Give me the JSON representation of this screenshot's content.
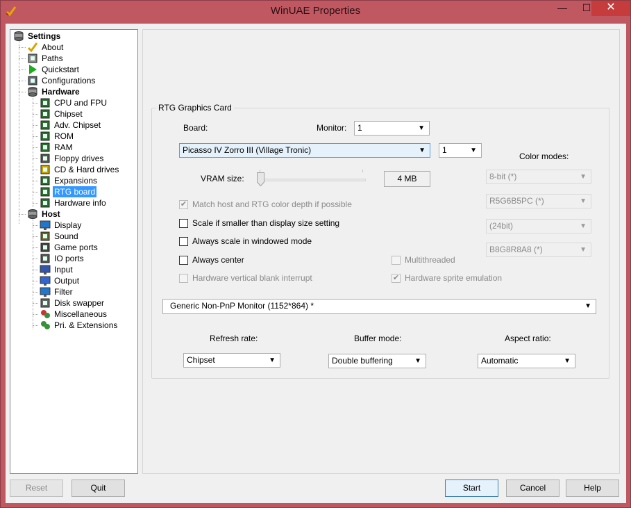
{
  "window": {
    "title": "WinUAE Properties",
    "minimize": "—",
    "maximize": "☐",
    "close": "✕"
  },
  "tree": [
    {
      "label": "Settings",
      "bold": true,
      "icon": "settings-icon"
    },
    {
      "label": "About",
      "icon": "checkmark-icon"
    },
    {
      "label": "Paths",
      "icon": "paths-icon"
    },
    {
      "label": "Quickstart",
      "icon": "play-icon"
    },
    {
      "label": "Configurations",
      "icon": "configurations-icon"
    },
    {
      "label": "Hardware",
      "bold": true,
      "icon": "hardware-icon"
    },
    {
      "label": "CPU and FPU",
      "icon": "chip-icon"
    },
    {
      "label": "Chipset",
      "icon": "chip-icon"
    },
    {
      "label": "Adv. Chipset",
      "icon": "chip-icon"
    },
    {
      "label": "ROM",
      "icon": "chip-icon"
    },
    {
      "label": "RAM",
      "icon": "chip-icon"
    },
    {
      "label": "Floppy drives",
      "icon": "floppy-drive-icon"
    },
    {
      "label": "CD & Hard drives",
      "icon": "hard-drive-icon"
    },
    {
      "label": "Expansions",
      "icon": "expansion-icon"
    },
    {
      "label": "RTG board",
      "icon": "rtg-board-icon",
      "selected": true
    },
    {
      "label": "Hardware info",
      "icon": "hardware-info-icon"
    },
    {
      "label": "Host",
      "bold": true,
      "icon": "host-icon"
    },
    {
      "label": "Display",
      "icon": "display-icon"
    },
    {
      "label": "Sound",
      "icon": "sound-icon"
    },
    {
      "label": "Game ports",
      "icon": "joystick-icon"
    },
    {
      "label": "IO ports",
      "icon": "io-port-icon"
    },
    {
      "label": "Input",
      "icon": "input-icon"
    },
    {
      "label": "Output",
      "icon": "output-icon"
    },
    {
      "label": "Filter",
      "icon": "filter-icon"
    },
    {
      "label": "Disk swapper",
      "icon": "disk-swapper-icon"
    },
    {
      "label": "Miscellaneous",
      "icon": "miscellaneous-icon"
    },
    {
      "label": "Pri. & Extensions",
      "icon": "extensions-icon"
    }
  ],
  "rtg": {
    "group_title": "RTG Graphics Card",
    "board_label": "Board:",
    "monitor_label": "Monitor:",
    "monitor_value": "1",
    "board_value": "Picasso IV Zorro III (Village Tronic)",
    "board_index": "1",
    "color_modes_label": "Color modes:",
    "vram_label": "VRAM size:",
    "vram_value": "4 MB",
    "vram_slider_fraction": 0,
    "match_depth": "Match host and RTG color depth if possible",
    "scale_smaller": "Scale if smaller than display size setting",
    "always_scale": "Always scale in windowed mode",
    "always_center": "Always center",
    "hw_vblank": "Hardware vertical blank interrupt",
    "multithreaded": "Multithreaded",
    "hw_sprite": "Hardware sprite emulation",
    "color_mode_8bit": "8-bit (*)",
    "color_mode_16bit": "R5G6B5PC (*)",
    "color_mode_24bit": "(24bit)",
    "color_mode_32bit": "B8G8R8A8 (*)",
    "monitor_type": "Generic Non-PnP Monitor (1152*864) *",
    "refresh_label": "Refresh rate:",
    "refresh_value": "Chipset",
    "buffer_label": "Buffer mode:",
    "buffer_value": "Double buffering",
    "aspect_label": "Aspect ratio:",
    "aspect_value": "Automatic",
    "check_mark": "✔"
  },
  "buttons": {
    "reset": "Reset",
    "quit": "Quit",
    "start": "Start",
    "cancel": "Cancel",
    "help": "Help"
  },
  "arrow": "▼"
}
